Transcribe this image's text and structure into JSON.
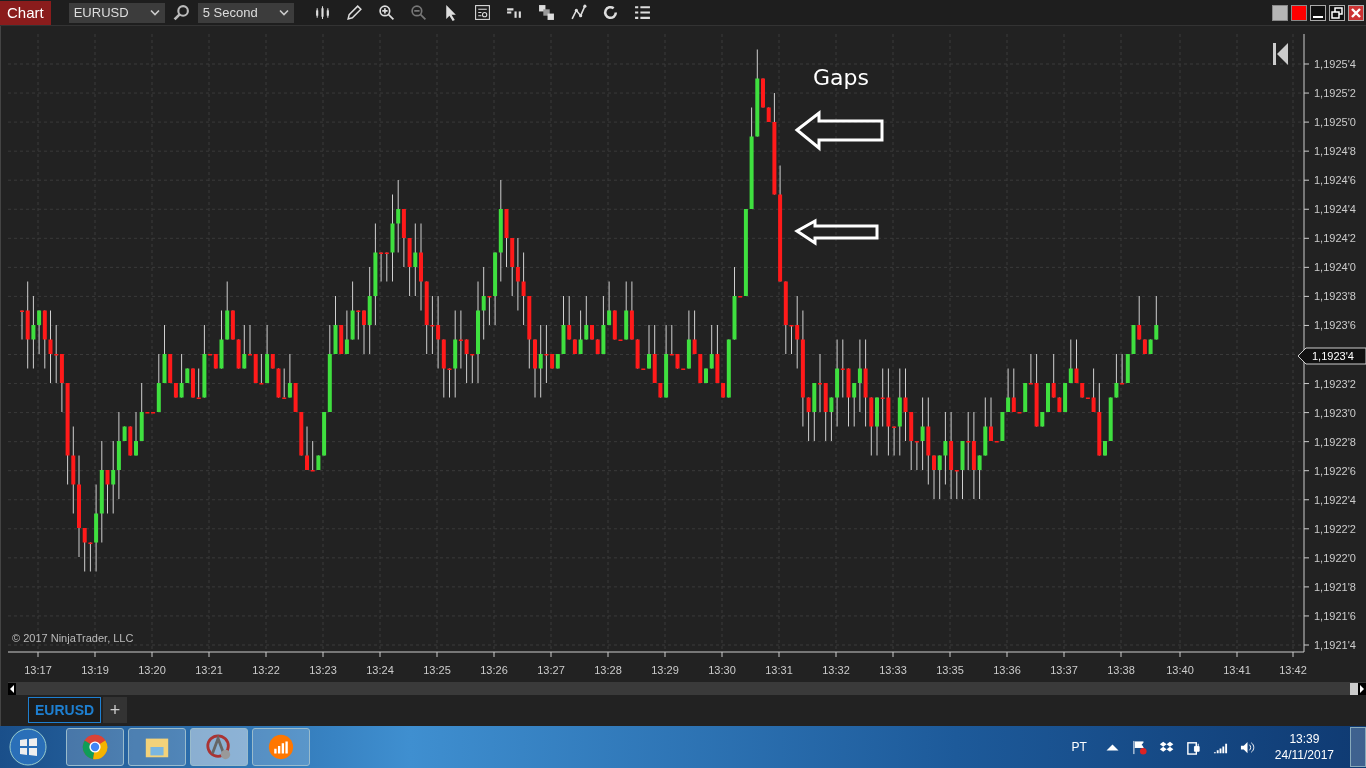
{
  "toolbar": {
    "title": "Chart",
    "instrument": "EURUSD",
    "interval": "5 Second"
  },
  "chart": {
    "annotation": "Gaps",
    "copyright": "© 2017 NinjaTrader, LLC",
    "current_price": "1,1923'4",
    "price_labels": [
      "1,1925'4",
      "1,1925'2",
      "1,1925'0",
      "1,1924'8",
      "1,1924'6",
      "1,1924'4",
      "1,1924'2",
      "1,1924'0",
      "1,1923'8",
      "1,1923'6",
      "1,1923'2",
      "1,1923'0",
      "1,1922'8",
      "1,1922'6",
      "1,1922'4",
      "1,1922'2",
      "1,1922'0",
      "1,1921'8",
      "1,1921'6",
      "1,1921'4"
    ],
    "time_labels": [
      "13:17",
      "13:19",
      "13:20",
      "13:21",
      "13:22",
      "13:23",
      "13:24",
      "13:25",
      "13:26",
      "13:27",
      "13:28",
      "13:29",
      "13:30",
      "13:31",
      "13:32",
      "13:33",
      "13:35",
      "13:36",
      "13:37",
      "13:38",
      "13:40",
      "13:41",
      "13:42"
    ]
  },
  "tabs": [
    {
      "label": "EURUSD",
      "selected": true
    }
  ],
  "add_tab": "+",
  "taskbar": {
    "language": "PT",
    "time": "13:39",
    "date": "24/11/2017"
  }
}
